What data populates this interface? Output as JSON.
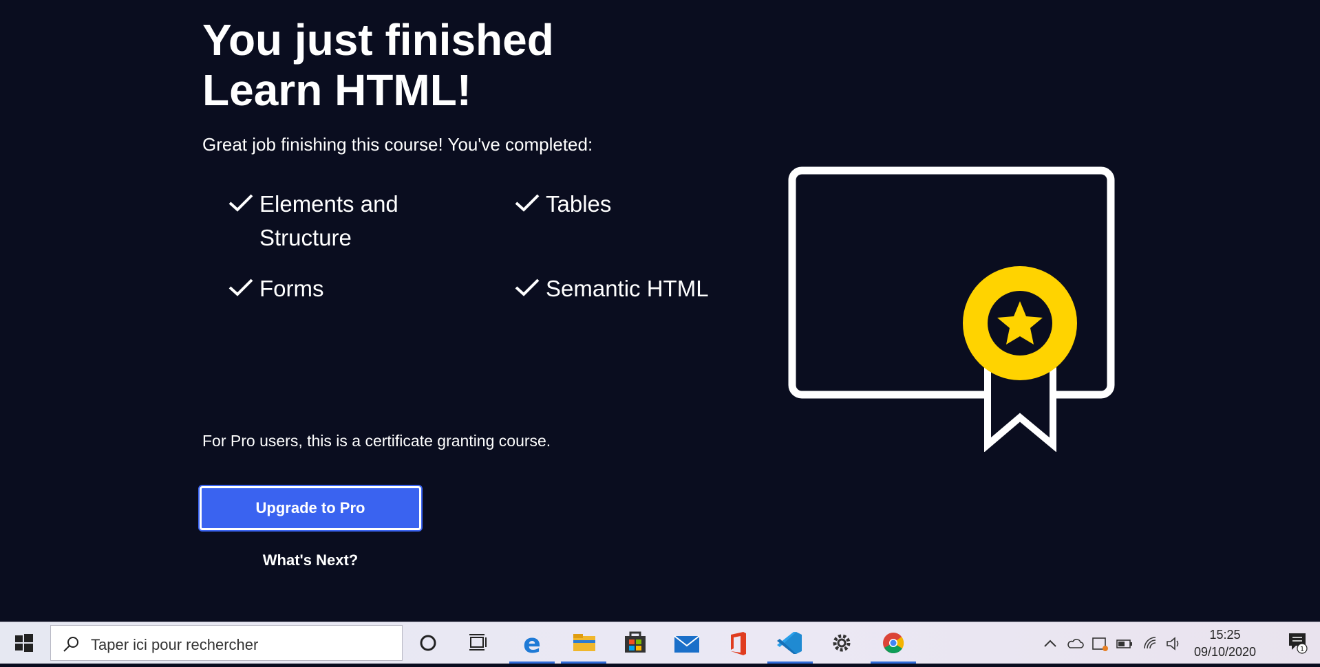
{
  "hero": {
    "title_line1": "You just finished",
    "title_line2": "Learn HTML!",
    "intro": "Great job finishing this course! You've completed:"
  },
  "topics": [
    {
      "label": "Elements and Structure"
    },
    {
      "label": "Tables"
    },
    {
      "label": "Forms"
    },
    {
      "label": "Semantic HTML"
    }
  ],
  "pro_note": "For Pro users, this is a certificate granting course.",
  "buttons": {
    "upgrade": "Upgrade to Pro",
    "whats_next": "What's Next?"
  },
  "colors": {
    "background": "#0a0d1f",
    "accent": "#3a63f0",
    "badge": "#ffd300"
  },
  "taskbar": {
    "search_placeholder": "Taper ici pour rechercher",
    "time": "15:25",
    "date": "09/10/2020",
    "notification_count": "1",
    "pinned_apps": [
      "edge-icon",
      "file-explorer-icon",
      "store-icon",
      "mail-icon",
      "office-icon",
      "vscode-icon",
      "settings-icon",
      "chrome-icon"
    ]
  }
}
